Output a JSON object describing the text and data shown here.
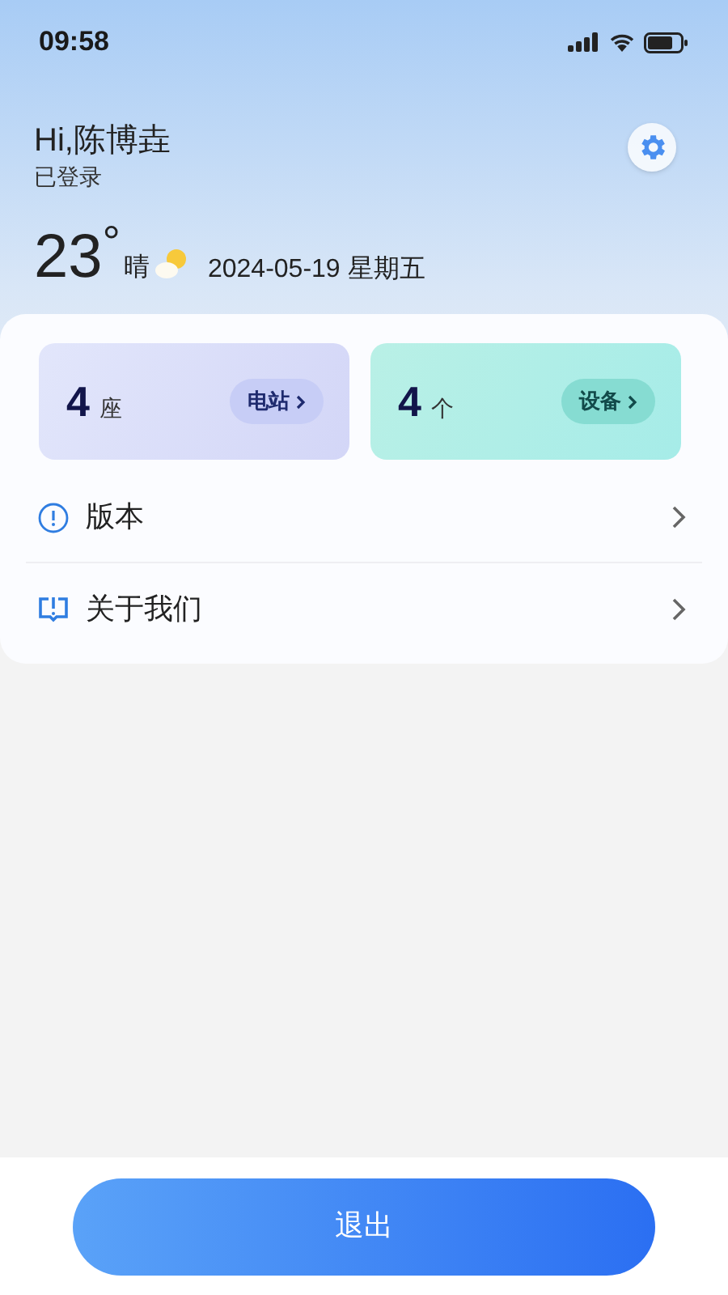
{
  "status_bar": {
    "time": "09:58"
  },
  "user": {
    "greeting": "Hi,陈博垚",
    "status": "已登录"
  },
  "weather": {
    "temperature": "23",
    "degree": "°",
    "condition": "晴",
    "date": "2024-05-19 星期五"
  },
  "stats": [
    {
      "kind": "stations",
      "count": "4",
      "unit": "座",
      "button": "电站"
    },
    {
      "kind": "devices",
      "count": "4",
      "unit": "个",
      "button": "设备"
    }
  ],
  "menu": [
    {
      "kind": "info",
      "label": "版本"
    },
    {
      "kind": "about",
      "label": "关于我们"
    }
  ],
  "logout": "退出"
}
